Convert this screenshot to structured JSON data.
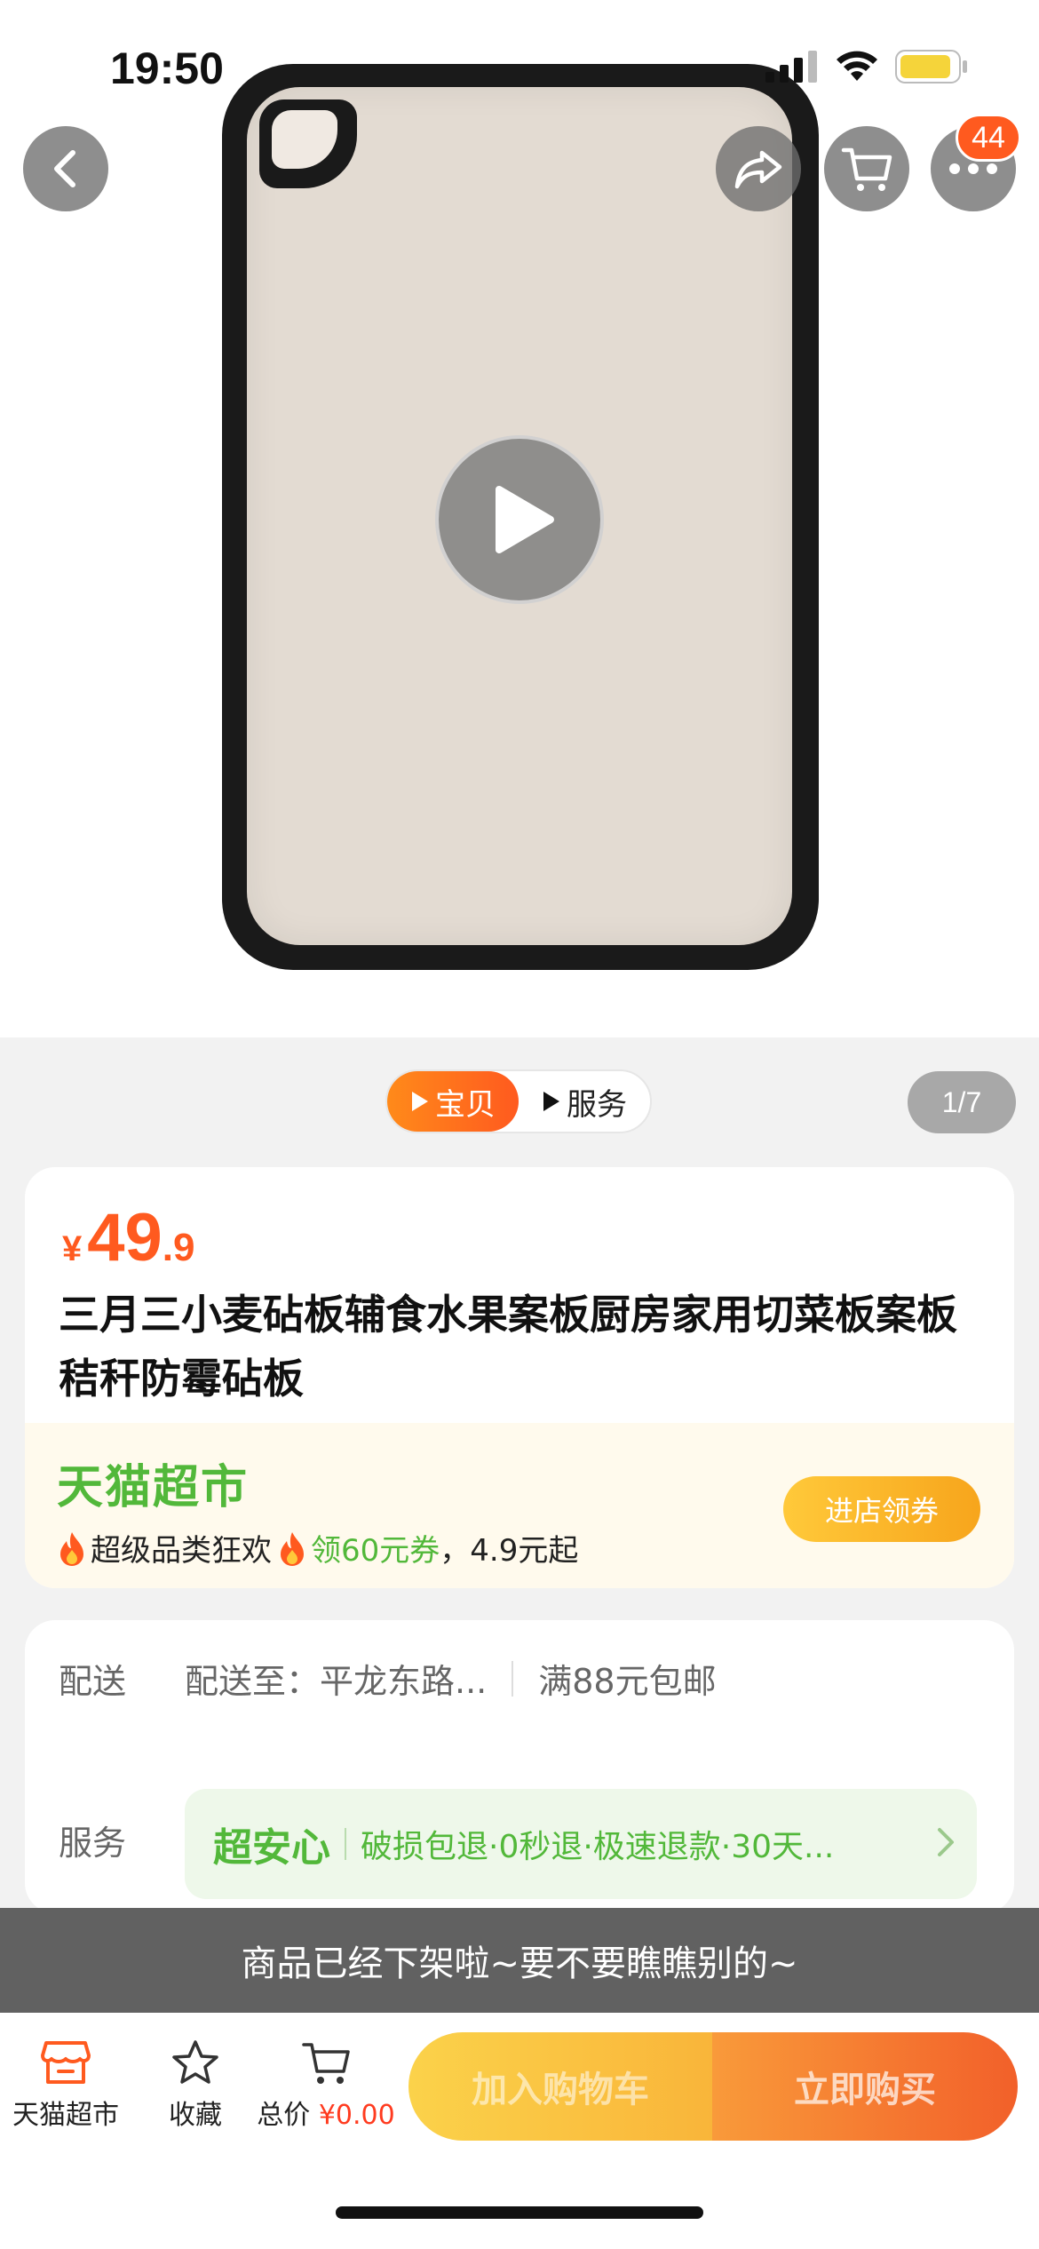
{
  "status_bar": {
    "time": "19:50"
  },
  "header": {
    "cart_badge": "44"
  },
  "media": {
    "tabs": [
      {
        "label": "宝贝",
        "active": true
      },
      {
        "label": "服务",
        "active": false
      }
    ],
    "page_indicator": "1/7"
  },
  "product": {
    "price_symbol": "¥",
    "price_integer": "49",
    "price_decimal": ".9",
    "title": "三月三小麦砧板辅食水果案板厨房家用切菜板案板秸秆防霉砧板"
  },
  "store": {
    "name": "天猫超市",
    "promo_prefix": "超级品类狂欢",
    "promo_coupon": "领60元券",
    "promo_suffix": "，4.9元起",
    "enter_button": "进店领券"
  },
  "delivery": {
    "label": "配送",
    "address": "配送至：平龙东路...",
    "shipping": "满88元包邮"
  },
  "service": {
    "label": "服务",
    "brand": "超安心",
    "details": "破损包退·0秒退·极速退款·30天..."
  },
  "toast": "商品已经下架啦~要不要瞧瞧别的~",
  "bottom_bar": {
    "store_label": "天猫超市",
    "favorite_label": "收藏",
    "total_label": "总价",
    "total_value": "¥0.00",
    "add_to_cart": "加入购物车",
    "buy_now": "立即购买"
  },
  "colors": {
    "accent": "#ff5a1f",
    "tmall_green": "#52b83a",
    "toast_bg": "#5c5c5c"
  },
  "icons": [
    "back-icon",
    "share-icon",
    "cart-icon",
    "more-icon",
    "play-icon",
    "store-icon",
    "star-icon",
    "chevron-right-icon",
    "flame-icon"
  ]
}
